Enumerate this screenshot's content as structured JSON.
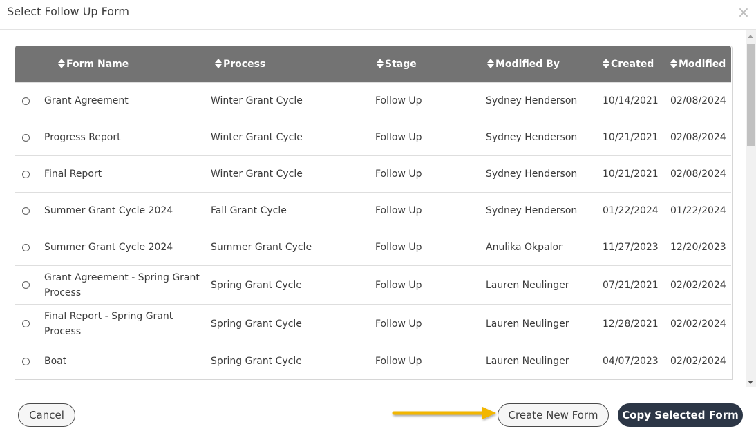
{
  "dialog": {
    "title": "Select Follow Up Form",
    "close_icon": "close-icon",
    "close_glyph": "×"
  },
  "table": {
    "columns": [
      "Form Name",
      "Process",
      "Stage",
      "Modified By",
      "Created",
      "Modified"
    ],
    "sort_icon": "sort-icon",
    "rows": [
      [
        "Grant Agreement",
        "Winter Grant Cycle",
        "Follow Up",
        "Sydney Henderson",
        "10/14/2021",
        "02/08/2024"
      ],
      [
        "Progress Report",
        "Winter Grant Cycle",
        "Follow Up",
        "Sydney Henderson",
        "10/21/2021",
        "02/08/2024"
      ],
      [
        "Final Report",
        "Winter Grant Cycle",
        "Follow Up",
        "Sydney Henderson",
        "10/21/2021",
        "02/08/2024"
      ],
      [
        "Summer Grant Cycle 2024",
        "Fall Grant Cycle",
        "Follow Up",
        "Sydney Henderson",
        "01/22/2024",
        "01/22/2024"
      ],
      [
        "Summer Grant Cycle 2024",
        "Summer Grant Cycle",
        "Follow Up",
        "Anulika Okpalor",
        "11/27/2023",
        "12/20/2023"
      ],
      [
        "Grant Agreement - Spring Grant Process",
        "Spring Grant Cycle",
        "Follow Up",
        "Lauren Neulinger",
        "07/21/2021",
        "02/02/2024"
      ],
      [
        "Final Report - Spring Grant Process",
        "Spring Grant Cycle",
        "Follow Up",
        "Lauren Neulinger",
        "12/28/2021",
        "02/02/2024"
      ],
      [
        "Boat",
        "Spring Grant Cycle",
        "Follow Up",
        "Lauren Neulinger",
        "04/07/2023",
        "02/02/2024"
      ]
    ]
  },
  "footer": {
    "cancel_label": "Cancel",
    "create_label": "Create New Form",
    "copy_label": "Copy Selected Form",
    "annotation": "arrow-annotation-icon"
  },
  "colors": {
    "header_bg": "#737373",
    "primary_button": "#2c3646",
    "annotation_arrow": "#f2b600"
  }
}
